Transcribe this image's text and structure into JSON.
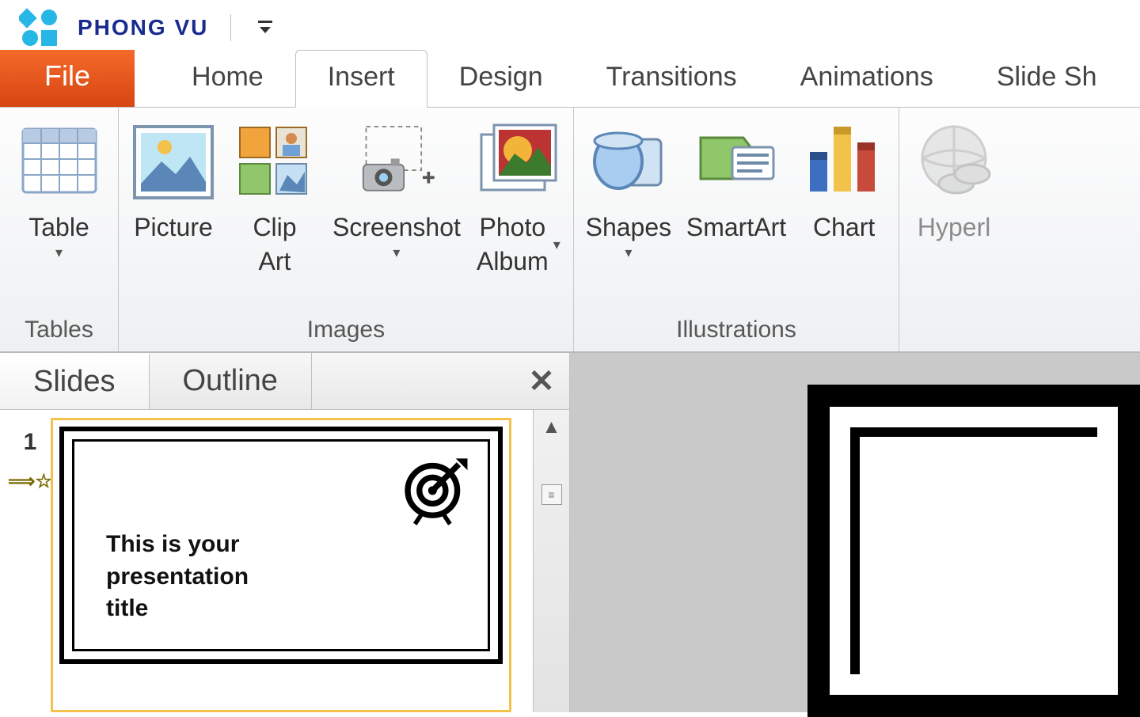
{
  "brand": {
    "text": "PHONG VU"
  },
  "tabs": {
    "file": "File",
    "items": [
      "Home",
      "Insert",
      "Design",
      "Transitions",
      "Animations",
      "Slide Sh"
    ],
    "active_index": 1
  },
  "ribbon": {
    "groups": [
      {
        "label": "Tables",
        "buttons": [
          {
            "key": "table",
            "label": "Table",
            "dropdown": true
          }
        ]
      },
      {
        "label": "Images",
        "buttons": [
          {
            "key": "picture",
            "label": "Picture",
            "dropdown": false
          },
          {
            "key": "clipart",
            "label": "Clip\nArt",
            "dropdown": false
          },
          {
            "key": "screenshot",
            "label": "Screenshot",
            "dropdown": true
          },
          {
            "key": "photoalbum",
            "label": "Photo\nAlbum",
            "dropdown": true
          }
        ]
      },
      {
        "label": "Illustrations",
        "buttons": [
          {
            "key": "shapes",
            "label": "Shapes",
            "dropdown": true
          },
          {
            "key": "smartart",
            "label": "SmartArt",
            "dropdown": false
          },
          {
            "key": "chart",
            "label": "Chart",
            "dropdown": false
          }
        ]
      },
      {
        "label": "",
        "buttons": [
          {
            "key": "hyperlink",
            "label": "Hyperl",
            "dropdown": false,
            "dim": true
          }
        ]
      }
    ]
  },
  "pane": {
    "tabs": {
      "slides": "Slides",
      "outline": "Outline"
    },
    "slide_number": "1",
    "slide_title": "This is your\npresentation\ntitle"
  }
}
